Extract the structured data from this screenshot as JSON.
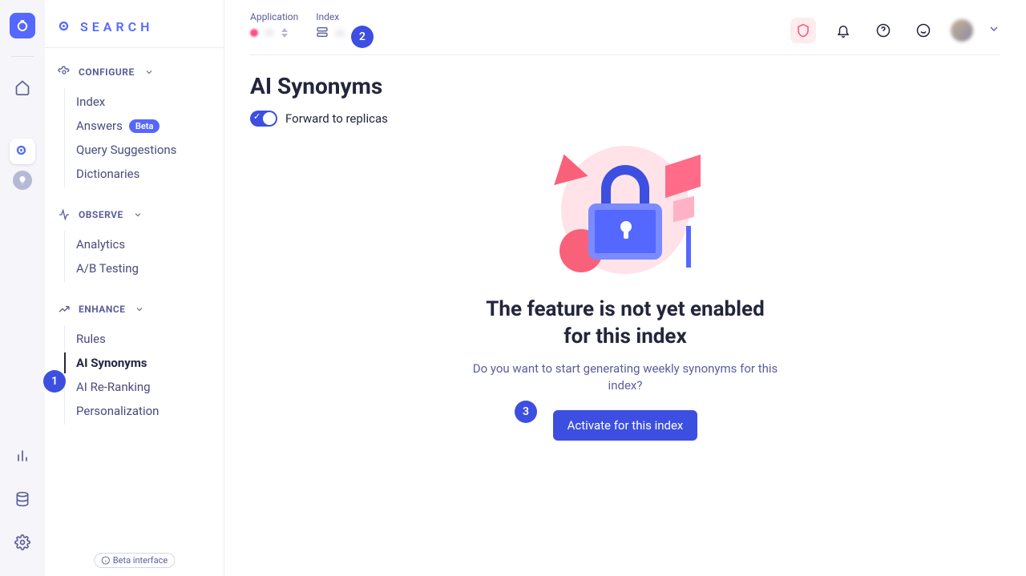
{
  "brand": "SEARCH",
  "rail": {
    "hint": ""
  },
  "sidebar": {
    "sections": [
      {
        "label": "CONFIGURE",
        "items": [
          {
            "label": "Index"
          },
          {
            "label": "Answers",
            "badge": "Beta"
          },
          {
            "label": "Query Suggestions"
          },
          {
            "label": "Dictionaries"
          }
        ]
      },
      {
        "label": "OBSERVE",
        "items": [
          {
            "label": "Analytics"
          },
          {
            "label": "A/B Testing"
          }
        ]
      },
      {
        "label": "ENHANCE",
        "items": [
          {
            "label": "Rules"
          },
          {
            "label": "AI Synonyms"
          },
          {
            "label": "AI Re-Ranking"
          },
          {
            "label": "Personalization"
          }
        ]
      }
    ],
    "beta_chip": "Beta interface"
  },
  "top": {
    "app_label": "Application",
    "app_value": "—",
    "index_label": "Index",
    "index_value": "—"
  },
  "page": {
    "title": "AI Synonyms",
    "toggle_label": "Forward to replicas",
    "empty_title_1": "The feature is not yet enabled",
    "empty_title_2": "for this index",
    "empty_sub": "Do you want to start generating weekly synonyms for this index?",
    "activate_btn": "Activate for this index"
  },
  "annotations": {
    "a1": "1",
    "a2": "2",
    "a3": "3"
  }
}
